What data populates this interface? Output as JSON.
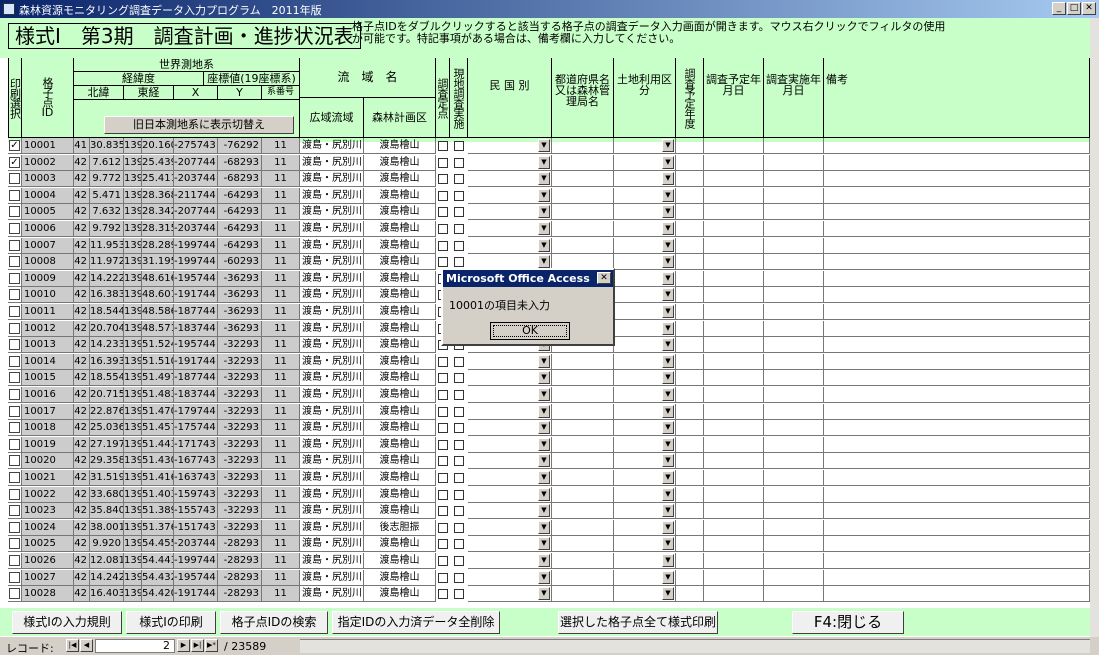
{
  "window": {
    "title": "森林資源モニタリング調査データ入力プログラム　2011年版",
    "min_label": "_",
    "max_label": "□",
    "close_label": "✕"
  },
  "form": {
    "title": "様式Ⅰ　第3期　調査計画・進捗状況表",
    "help_text": "格子点IDをダブルクリックすると該当する格子点の調査データ入力画面が開きます。マウス右クリックでフィルタの使用\nが可能です。特記事項がある場合は、備考欄に入力してください。"
  },
  "headers": {
    "print_select": "印刷選択",
    "grid_id_top": "格子点",
    "grid_id_bottom": "ID",
    "world_geodetic": "世界測地系",
    "latlon": "経緯度",
    "coords": "座標値(19座標系)",
    "north_lat": "北緯",
    "east_lon": "東経",
    "x": "X",
    "y": "Y",
    "sysno": "系番号",
    "old_system_button": "旧日本測地系に表示切替え",
    "basin_name": "流　域　名",
    "wide_basin": "広域流域",
    "forest_plan": "森林計画区",
    "survey_point": "調査定点",
    "field_survey": "現地調査実施",
    "ownership": "民 国 別",
    "prefecture": "都道府県名又は森林管理局名",
    "land_use": "土地利用区分",
    "plan_year": "調査予定年度",
    "plan_date": "調査予定年月日",
    "actual_date": "調査実施年月日",
    "remarks": "備考"
  },
  "rows": [
    {
      "checked": true,
      "id": "10001",
      "lat_d": "41",
      "lat_m": "30.835",
      "lon_d": "139",
      "lon_m": "20.160",
      "x": "-275743",
      "y": "-76292",
      "sys": "11",
      "basin": "渡島・尻別川",
      "plan": "渡島檜山"
    },
    {
      "checked": true,
      "id": "10002",
      "lat_d": "42",
      "lat_m": "7.612",
      "lon_d": "139",
      "lon_m": "25.439",
      "x": "-207744",
      "y": "-68293",
      "sys": "11",
      "basin": "渡島・尻別川",
      "plan": "渡島檜山"
    },
    {
      "checked": false,
      "id": "10003",
      "lat_d": "42",
      "lat_m": "9.772",
      "lon_d": "139",
      "lon_m": "25.411",
      "x": "-203744",
      "y": "-68293",
      "sys": "11",
      "basin": "渡島・尻別川",
      "plan": "渡島檜山"
    },
    {
      "checked": false,
      "id": "10004",
      "lat_d": "42",
      "lat_m": "5.471",
      "lon_d": "139",
      "lon_m": "28.368",
      "x": "-211744",
      "y": "-64293",
      "sys": "11",
      "basin": "渡島・尻別川",
      "plan": "渡島檜山"
    },
    {
      "checked": false,
      "id": "10005",
      "lat_d": "42",
      "lat_m": "7.632",
      "lon_d": "139",
      "lon_m": "28.342",
      "x": "-207744",
      "y": "-64293",
      "sys": "11",
      "basin": "渡島・尻別川",
      "plan": "渡島檜山"
    },
    {
      "checked": false,
      "id": "10006",
      "lat_d": "42",
      "lat_m": "9.792",
      "lon_d": "139",
      "lon_m": "28.315",
      "x": "-203744",
      "y": "-64293",
      "sys": "11",
      "basin": "渡島・尻別川",
      "plan": "渡島檜山"
    },
    {
      "checked": false,
      "id": "10007",
      "lat_d": "42",
      "lat_m": "11.953",
      "lon_d": "139",
      "lon_m": "28.289",
      "x": "-199744",
      "y": "-64293",
      "sys": "11",
      "basin": "渡島・尻別川",
      "plan": "渡島檜山"
    },
    {
      "checked": false,
      "id": "10008",
      "lat_d": "42",
      "lat_m": "11.972",
      "lon_d": "139",
      "lon_m": "31.195",
      "x": "-199744",
      "y": "-60293",
      "sys": "11",
      "basin": "渡島・尻別川",
      "plan": "渡島檜山"
    },
    {
      "checked": false,
      "id": "10009",
      "lat_d": "42",
      "lat_m": "14.222",
      "lon_d": "139",
      "lon_m": "48.616",
      "x": "-195744",
      "y": "-36293",
      "sys": "11",
      "basin": "渡島・尻別川",
      "plan": "渡島檜山"
    },
    {
      "checked": false,
      "id": "10010",
      "lat_d": "42",
      "lat_m": "16.383",
      "lon_d": "139",
      "lon_m": "48.601",
      "x": "-191744",
      "y": "-36293",
      "sys": "11",
      "basin": "渡島・尻別川",
      "plan": "渡島檜山"
    },
    {
      "checked": false,
      "id": "10011",
      "lat_d": "42",
      "lat_m": "18.544",
      "lon_d": "139",
      "lon_m": "48.586",
      "x": "-187744",
      "y": "-36293",
      "sys": "11",
      "basin": "渡島・尻別川",
      "plan": "渡島檜山"
    },
    {
      "checked": false,
      "id": "10012",
      "lat_d": "42",
      "lat_m": "20.704",
      "lon_d": "139",
      "lon_m": "48.571",
      "x": "-183744",
      "y": "-36293",
      "sys": "11",
      "basin": "渡島・尻別川",
      "plan": "渡島檜山"
    },
    {
      "checked": false,
      "id": "10013",
      "lat_d": "42",
      "lat_m": "14.233",
      "lon_d": "139",
      "lon_m": "51.524",
      "x": "-195744",
      "y": "-32293",
      "sys": "11",
      "basin": "渡島・尻別川",
      "plan": "渡島檜山"
    },
    {
      "checked": false,
      "id": "10014",
      "lat_d": "42",
      "lat_m": "16.393",
      "lon_d": "139",
      "lon_m": "51.510",
      "x": "-191744",
      "y": "-32293",
      "sys": "11",
      "basin": "渡島・尻別川",
      "plan": "渡島檜山"
    },
    {
      "checked": false,
      "id": "10015",
      "lat_d": "42",
      "lat_m": "18.554",
      "lon_d": "139",
      "lon_m": "51.497",
      "x": "-187744",
      "y": "-32293",
      "sys": "11",
      "basin": "渡島・尻別川",
      "plan": "渡島檜山"
    },
    {
      "checked": false,
      "id": "10016",
      "lat_d": "42",
      "lat_m": "20.715",
      "lon_d": "139",
      "lon_m": "51.483",
      "x": "-183744",
      "y": "-32293",
      "sys": "11",
      "basin": "渡島・尻別川",
      "plan": "渡島檜山"
    },
    {
      "checked": false,
      "id": "10017",
      "lat_d": "42",
      "lat_m": "22.876",
      "lon_d": "139",
      "lon_m": "51.470",
      "x": "-179744",
      "y": "-32293",
      "sys": "11",
      "basin": "渡島・尻別川",
      "plan": "渡島檜山"
    },
    {
      "checked": false,
      "id": "10018",
      "lat_d": "42",
      "lat_m": "25.036",
      "lon_d": "139",
      "lon_m": "51.457",
      "x": "-175744",
      "y": "-32293",
      "sys": "11",
      "basin": "渡島・尻別川",
      "plan": "渡島檜山"
    },
    {
      "checked": false,
      "id": "10019",
      "lat_d": "42",
      "lat_m": "27.197",
      "lon_d": "139",
      "lon_m": "51.443",
      "x": "-171743",
      "y": "-32293",
      "sys": "11",
      "basin": "渡島・尻別川",
      "plan": "渡島檜山"
    },
    {
      "checked": false,
      "id": "10020",
      "lat_d": "42",
      "lat_m": "29.358",
      "lon_d": "139",
      "lon_m": "51.430",
      "x": "-167743",
      "y": "-32293",
      "sys": "11",
      "basin": "渡島・尻別川",
      "plan": "渡島檜山"
    },
    {
      "checked": false,
      "id": "10021",
      "lat_d": "42",
      "lat_m": "31.519",
      "lon_d": "139",
      "lon_m": "51.416",
      "x": "-163743",
      "y": "-32293",
      "sys": "11",
      "basin": "渡島・尻別川",
      "plan": "渡島檜山"
    },
    {
      "checked": false,
      "id": "10022",
      "lat_d": "42",
      "lat_m": "33.680",
      "lon_d": "139",
      "lon_m": "51.403",
      "x": "-159743",
      "y": "-32293",
      "sys": "11",
      "basin": "渡島・尻別川",
      "plan": "渡島檜山"
    },
    {
      "checked": false,
      "id": "10023",
      "lat_d": "42",
      "lat_m": "35.840",
      "lon_d": "139",
      "lon_m": "51.389",
      "x": "-155743",
      "y": "-32293",
      "sys": "11",
      "basin": "渡島・尻別川",
      "plan": "渡島檜山"
    },
    {
      "checked": false,
      "id": "10024",
      "lat_d": "42",
      "lat_m": "38.001",
      "lon_d": "139",
      "lon_m": "51.376",
      "x": "-151743",
      "y": "-32293",
      "sys": "11",
      "basin": "渡島・尻別川",
      "plan": "後志胆振"
    },
    {
      "checked": false,
      "id": "10025",
      "lat_d": "42",
      "lat_m": "9.920",
      "lon_d": "139",
      "lon_m": "54.455",
      "x": "-203744",
      "y": "-28293",
      "sys": "11",
      "basin": "渡島・尻別川",
      "plan": "渡島檜山"
    },
    {
      "checked": false,
      "id": "10026",
      "lat_d": "42",
      "lat_m": "12.081",
      "lon_d": "139",
      "lon_m": "54.443",
      "x": "-199744",
      "y": "-28293",
      "sys": "11",
      "basin": "渡島・尻別川",
      "plan": "渡島檜山"
    },
    {
      "checked": false,
      "id": "10027",
      "lat_d": "42",
      "lat_m": "14.242",
      "lon_d": "139",
      "lon_m": "54.432",
      "x": "-195744",
      "y": "-28293",
      "sys": "11",
      "basin": "渡島・尻別川",
      "plan": "渡島檜山"
    },
    {
      "checked": false,
      "id": "10028",
      "lat_d": "42",
      "lat_m": "16.403",
      "lon_d": "139",
      "lon_m": "54.420",
      "x": "-191744",
      "y": "-28293",
      "sys": "11",
      "basin": "渡島・尻別川",
      "plan": "渡島檜山"
    }
  ],
  "dialog": {
    "title": "Microsoft Office Access",
    "message": "10001の項目未入力",
    "ok_label": "OK",
    "close_label": "✕"
  },
  "footer": {
    "input_rules": "様式Ⅰの入力規則",
    "print": "様式Ⅰの印刷",
    "search_id": "格子点IDの検索",
    "delete_all": "指定IDの入力済データ全削除",
    "print_selected": "選択した格子点全て様式印刷",
    "close": "F4:閉じる"
  },
  "navigation": {
    "record_label": "レコード:",
    "current": "2",
    "total": "/ 23589",
    "first": "|◀",
    "prev": "◀",
    "next": "▶",
    "last": "▶|",
    "new": "▶*"
  },
  "colors": {
    "header_bg": "#c8ffc8",
    "gray_cell": "#cccccc",
    "dialog_title": "#0a246a"
  }
}
